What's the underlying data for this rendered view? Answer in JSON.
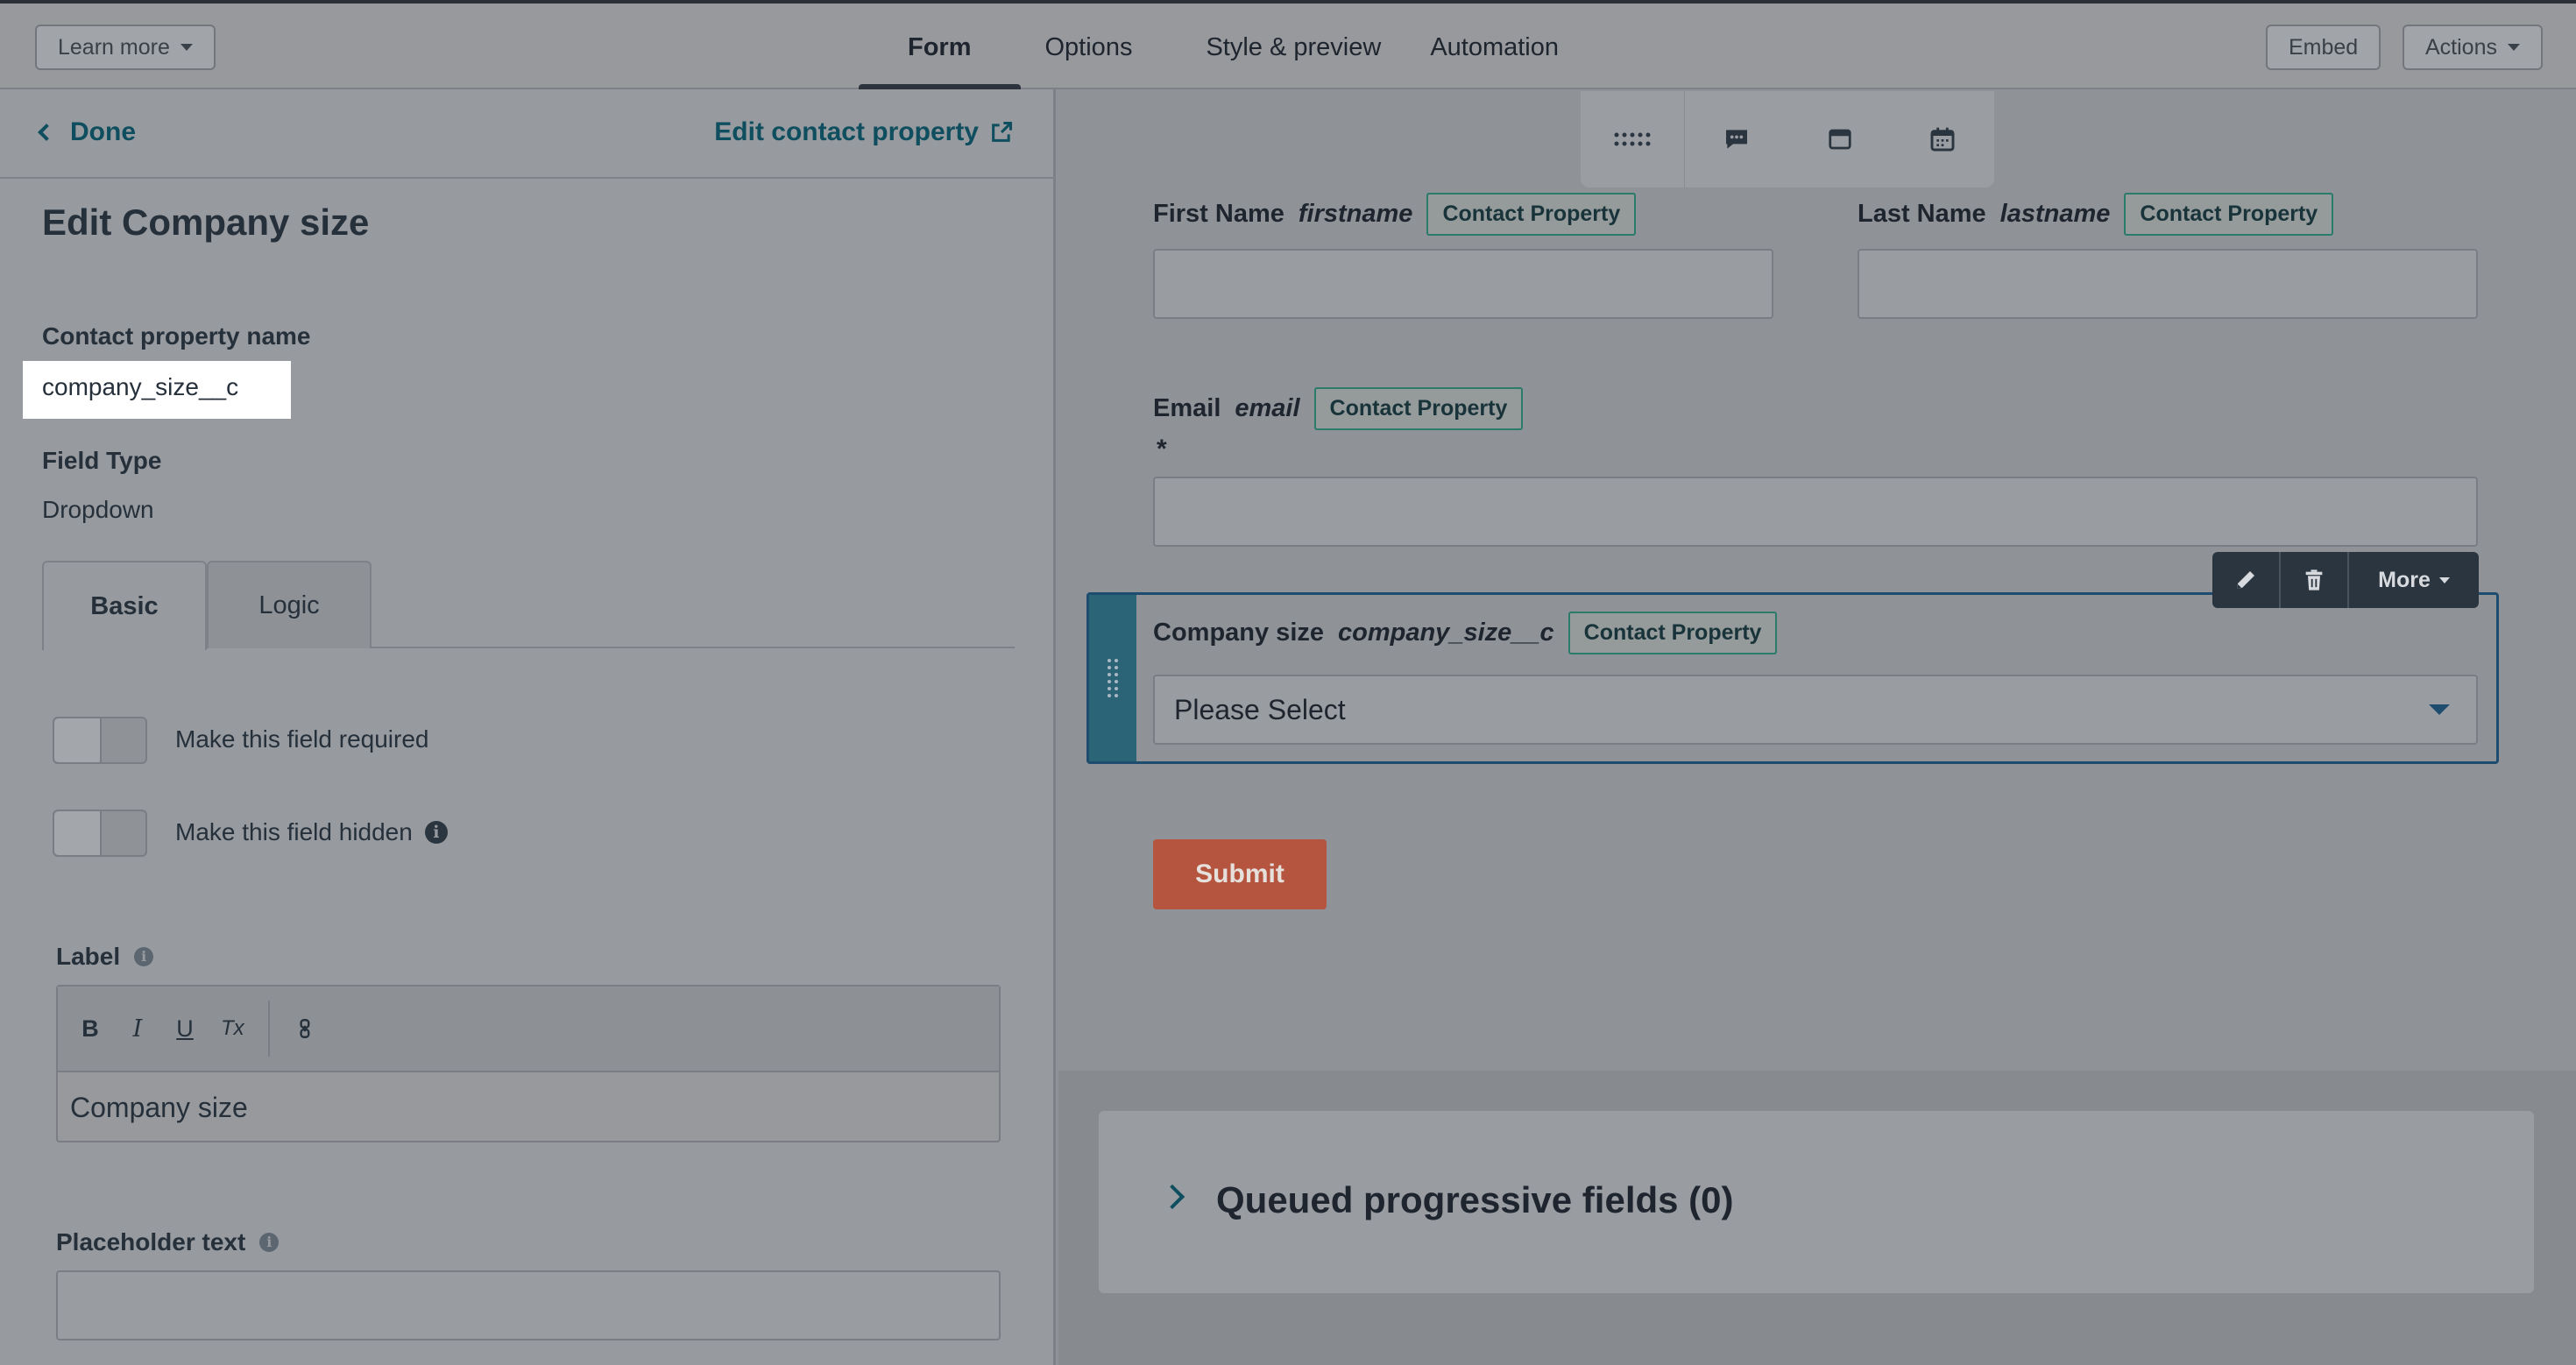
{
  "topbar": {
    "learn_more": "Learn more",
    "tabs": [
      {
        "label": "Form",
        "active": true
      },
      {
        "label": "Options",
        "active": false
      },
      {
        "label": "Style & preview",
        "active": false
      },
      {
        "label": "Automation",
        "active": false
      }
    ],
    "embed": "Embed",
    "actions": "Actions"
  },
  "left_panel": {
    "done": "Done",
    "edit_contact_property": "Edit contact property",
    "title": "Edit Company size",
    "property_name_label": "Contact property name",
    "property_name_value": "company_size__c",
    "field_type_label": "Field Type",
    "field_type_value": "Dropdown",
    "tabs": [
      {
        "label": "Basic",
        "active": true
      },
      {
        "label": "Logic",
        "active": false
      }
    ],
    "required_label": "Make this field required",
    "required_on": false,
    "hidden_label": "Make this field hidden",
    "hidden_on": false,
    "label_label": "Label",
    "editor_toolbar": {
      "bold": "B",
      "italic": "I",
      "underline": "U",
      "clear": "Tx"
    },
    "label_value": "Company size",
    "placeholder_label": "Placeholder text",
    "placeholder_value": ""
  },
  "preview": {
    "first_name": {
      "label": "First Name",
      "internal": "firstname",
      "badge": "Contact Property"
    },
    "last_name": {
      "label": "Last Name",
      "internal": "lastname",
      "badge": "Contact Property"
    },
    "email": {
      "label": "Email",
      "internal": "email",
      "badge": "Contact Property",
      "required_mark": "*"
    },
    "company_size": {
      "label": "Company size",
      "internal": "company_size__c",
      "badge": "Contact Property",
      "select_value": "Please Select"
    },
    "field_actions": {
      "more": "More"
    },
    "submit": "Submit",
    "queued": "Queued progressive fields (0)"
  },
  "colors": {
    "accent_teal": "#0e4e5e",
    "submit": "#b5553f",
    "badge_border": "#2a7b69",
    "dark_toolbar": "#2b3540"
  }
}
